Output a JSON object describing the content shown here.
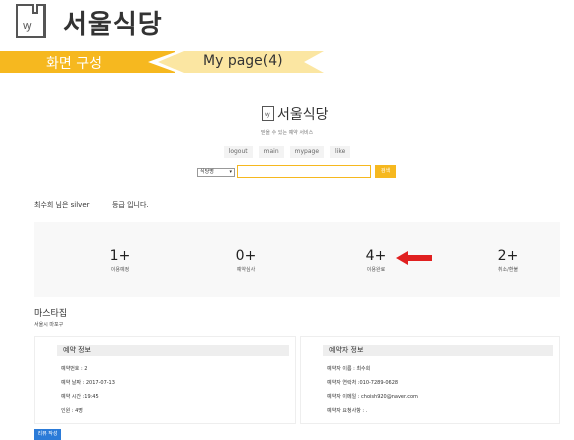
{
  "slide": {
    "title": "서울식당",
    "section_label": "화면 구성",
    "page_label": "My page(4)",
    "colors": {
      "accent": "#f6b81f",
      "accent_light": "#fbe6a2",
      "arrow": "#e02020",
      "button": "#2b7bd8"
    }
  },
  "app": {
    "name": "서울식당",
    "tagline": "믿을 수 있는 예약 서비스",
    "nav": [
      "logout",
      "main",
      "mypage",
      "like"
    ],
    "search": {
      "select_value": "식당명",
      "input_value": "",
      "button_label": "검색"
    }
  },
  "user": {
    "grade_prefix": "최수희 님은 silver",
    "grade_suffix": "등급 입니다."
  },
  "stats": [
    {
      "value": "1+",
      "label": "이용예정"
    },
    {
      "value": "0+",
      "label": "예약심사"
    },
    {
      "value": "4+",
      "label": "이용완료"
    },
    {
      "value": "2+",
      "label": "취소/환불"
    }
  ],
  "restaurant": {
    "name": "마스타집",
    "address": "서울시 마포구"
  },
  "reservation": {
    "header": "예약 정보",
    "rows": [
      "예약번호 : 2",
      "예약 날짜 : 2017-07-13",
      "예약 시간 :19:45",
      "인원 : 4명"
    ]
  },
  "reserver": {
    "header": "예약자 정보",
    "rows": [
      "예약자 이름 : 최수희",
      "예약자 연락처 :010-7289-0628",
      "예약자 이메일 : choish920@naver.com",
      "예약자 요청사항 : ."
    ]
  },
  "review_button": "리뷰 작성"
}
